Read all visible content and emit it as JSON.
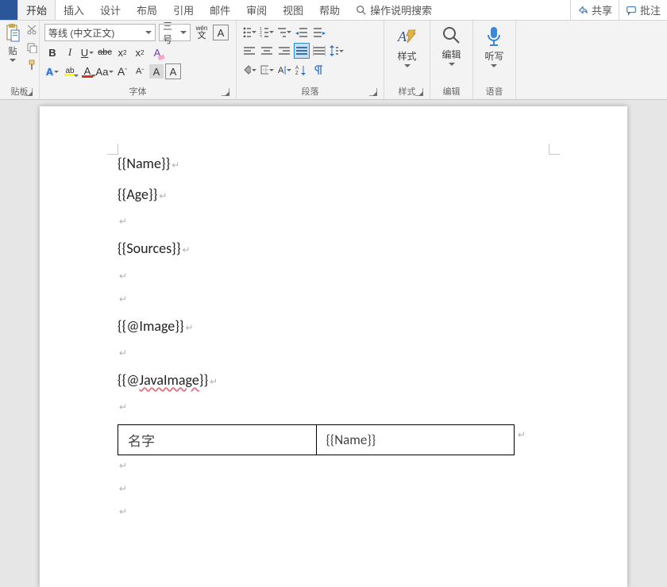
{
  "tabs": {
    "start": "开始",
    "insert": "插入",
    "design": "设计",
    "layout": "布局",
    "references": "引用",
    "mail": "邮件",
    "review": "审阅",
    "view": "视图",
    "help": "帮助",
    "tell_me": "操作说明搜索"
  },
  "titlebar_right": {
    "share": "共享",
    "comments": "批注"
  },
  "ribbon": {
    "clipboard": {
      "label": "贴板",
      "paste": "贴"
    },
    "font": {
      "label": "字体",
      "font_name": "等线 (中文正文)",
      "font_size": "三号",
      "phonetic": "wén",
      "phonetic_sub": "文",
      "charframe": "A",
      "bold": "B",
      "italic": "I",
      "underline": "U",
      "strike": "abc",
      "sub": "x",
      "sup": "x",
      "clearfmt": "A",
      "textfx": "A",
      "highlight": "ab",
      "fontcolor": "A",
      "changecase": "Aa",
      "grow": "A",
      "shrink": "A",
      "charshade": "A",
      "charborder": "A"
    },
    "paragraph": {
      "label": "段落"
    },
    "styles": {
      "label": "样式",
      "btn": "样式"
    },
    "editing": {
      "label": "编辑",
      "btn": "编辑"
    },
    "voice": {
      "label": "语音",
      "btn": "听写"
    }
  },
  "document": {
    "lines": [
      "{{Name}}",
      "{{Age}}",
      "",
      "{{Sources}}",
      "",
      "",
      "{{@Image}}",
      "",
      "{{@JavaImage}}",
      ""
    ],
    "table": {
      "c1": "名字",
      "c2": "{{Name}}"
    },
    "after_table": [
      "",
      "",
      ""
    ]
  }
}
